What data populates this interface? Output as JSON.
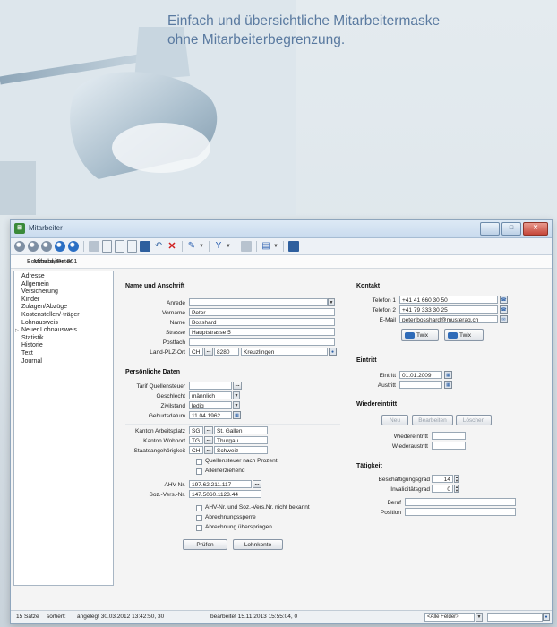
{
  "tagline": {
    "line1": "Einfach und übersichtliche Mitarbeitermaske",
    "line2": "ohne Mitarbeiterbegrenzung."
  },
  "window": {
    "title": "Mitarbeiter",
    "app_icon": "pages-icon",
    "controls": [
      "minimize-icon",
      "maximize-icon",
      "close-icon"
    ]
  },
  "subheader": {
    "label": "Mitarbeiter: 001",
    "name": "Bosshard, Peter"
  },
  "sidebar": {
    "items": [
      {
        "label": "Adresse"
      },
      {
        "label": "Allgemein"
      },
      {
        "label": "Versicherung"
      },
      {
        "label": "Kinder"
      },
      {
        "label": "Zulagen/Abzüge"
      },
      {
        "label": "Kostenstellen/-träger"
      },
      {
        "label": "Lohnausweis"
      },
      {
        "label": "Neuer Lohnausweis"
      },
      {
        "label": "Statistik"
      },
      {
        "label": "Historie"
      },
      {
        "label": "Text"
      },
      {
        "label": "Journal"
      }
    ]
  },
  "name_section": {
    "title": "Name und Anschrift",
    "anrede_label": "Anrede",
    "anrede_value": "",
    "vorname_label": "Vorname",
    "vorname_value": "Peter",
    "name_label": "Name",
    "name_value": "Bosshard",
    "strasse_label": "Strasse",
    "strasse_value": "Hauptstrasse 5",
    "postfach_label": "Postfach",
    "postfach_value": "",
    "landplz_label": "Land-PLZ-Ort",
    "land_value": "CH",
    "plz_value": "8280",
    "ort_value": "Kreuzlingen"
  },
  "personal_section": {
    "title": "Persönliche Daten",
    "tarif_label": "Tarif Quellensteuer",
    "geschlecht_label": "Geschlecht",
    "geschlecht_value": "männlich",
    "zivilstand_label": "Zivilstand",
    "zivilstand_value": "ledig",
    "geburtsdatum_label": "Geburtsdatum",
    "geburtsdatum_value": "11.04.1962",
    "kanton_arbeit_label": "Kanton Arbeitsplatz",
    "kanton_arbeit_code": "SG",
    "kanton_arbeit_name": "St. Gallen",
    "kanton_wohn_label": "Kanton Wohnort",
    "kanton_wohn_code": "TG",
    "kanton_wohn_name": "Thurgau",
    "staat_label": "Staatsangehörigkeit",
    "staat_code": "CH",
    "staat_name": "Schweiz",
    "chk_quellensteuer": "Quellensteuer nach Prozent",
    "chk_alleinerziehend": "Alleinerziehend",
    "ahv_label": "AHV-Nr.",
    "ahv_value": "197.62.211.117",
    "sozvers_label": "Soz.-Vers.-Nr.",
    "sozvers_value": "147.5060.1123.44",
    "chk_ahv_unbekannt": "AHV-Nr. und Soz.-Vers.Nr. nicht bekannt",
    "chk_abrechnungssperre": "Abrechnungssperre",
    "chk_ueberspringen": "Abrechnung überspringen",
    "btn_pruefen": "Prüfen",
    "btn_lohnkonto": "Lohnkonto"
  },
  "kontakt": {
    "title": "Kontakt",
    "tel1_label": "Telefon 1",
    "tel1_value": "+41 41 660 30 50",
    "tel2_label": "Telefon 2",
    "tel2_value": "+41 79 333 30 25",
    "email_label": "E-Mail",
    "email_value": "peter.bosshard@musterag.ch",
    "twix1": "Twix",
    "twix2": "Twix"
  },
  "eintritt": {
    "title": "Eintritt",
    "eintritt_label": "Eintritt",
    "eintritt_value": "01.01.2009",
    "austritt_label": "Austritt",
    "austritt_value": ""
  },
  "wiedereintritt": {
    "title": "Wiedereintritt",
    "btn_neu": "Neu",
    "btn_bearbeiten": "Bearbeiten",
    "btn_loeschen": "Löschen",
    "wiedereintritt_label": "Wiedereintritt",
    "wiederaustritt_label": "Wiederaustritt"
  },
  "taetigkeit": {
    "title": "Tätigkeit",
    "beschaeftigung_label": "Beschäftigungsgrad",
    "beschaeftigung_value": "14",
    "invalidit_label": "Invaliditätsgrad",
    "invalidit_value": "0",
    "beruf_label": "Beruf",
    "beruf_value": "",
    "position_label": "Position",
    "position_value": ""
  },
  "statusbar": {
    "saetze": "15 Sätze",
    "sortiert": "sortiert:",
    "angelegt": "angelegt 30.03.2012 13:42:50, 30",
    "bearbeitet": "bearbeitet 15.11.2013 15:55:04, 0",
    "filter": "<Alle Felder>"
  }
}
